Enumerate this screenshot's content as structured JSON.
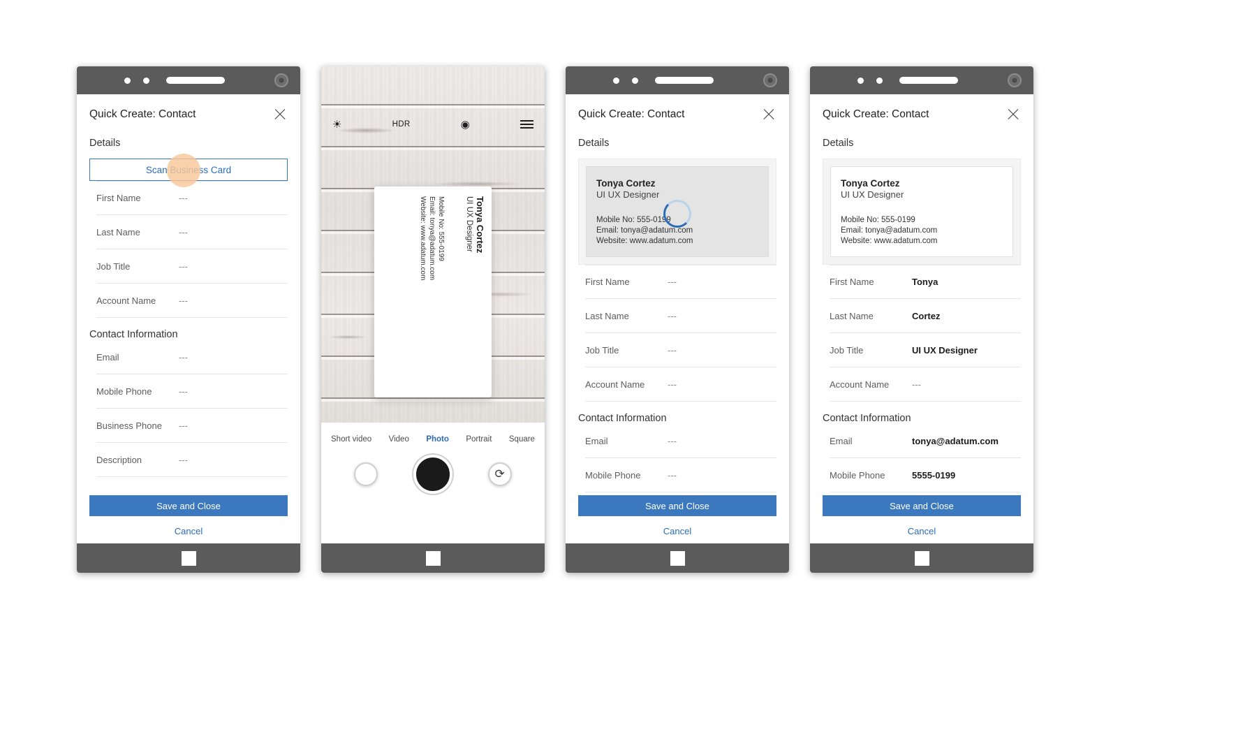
{
  "form": {
    "title": "Quick Create: Contact",
    "close_icon": "close-icon",
    "details_heading": "Details",
    "contact_info_heading": "Contact Information",
    "scan_button": "Scan Business Card",
    "save_button": "Save and Close",
    "cancel_link": "Cancel",
    "empty_value": "---"
  },
  "panel1": {
    "fields": [
      {
        "label": "First Name",
        "value": "---"
      },
      {
        "label": "Last Name",
        "value": "---"
      },
      {
        "label": "Job Title",
        "value": "---"
      },
      {
        "label": "Account Name",
        "value": "---"
      }
    ],
    "contact_fields": [
      {
        "label": "Email",
        "value": "---"
      },
      {
        "label": "Mobile Phone",
        "value": "---"
      },
      {
        "label": "Business Phone",
        "value": "---"
      },
      {
        "label": "Description",
        "value": "---"
      }
    ]
  },
  "panel3": {
    "card": {
      "name": "Tonya Cortez",
      "role": "UI UX Designer",
      "mobile": "Mobile No: 555-0199",
      "email": "Email: tonya@adatum.com",
      "website": "Website: www.adatum.com",
      "spinner": "loading-spinner"
    },
    "fields": [
      {
        "label": "First Name",
        "value": "---"
      },
      {
        "label": "Last Name",
        "value": "---"
      },
      {
        "label": "Job Title",
        "value": "---"
      },
      {
        "label": "Account Name",
        "value": "---"
      }
    ],
    "contact_fields": [
      {
        "label": "Email",
        "value": "---"
      },
      {
        "label": "Mobile Phone",
        "value": "---"
      }
    ]
  },
  "panel4": {
    "card": {
      "name": "Tonya Cortez",
      "role": "UI UX Designer",
      "mobile": "Mobile No: 555-0199",
      "email": "Email: tonya@adatum.com",
      "website": "Website: www.adatum.com"
    },
    "fields": [
      {
        "label": "First Name",
        "value": "Tonya"
      },
      {
        "label": "Last Name",
        "value": "Cortez"
      },
      {
        "label": "Job Title",
        "value": "UI UX Designer"
      },
      {
        "label": "Account Name",
        "value": "---"
      }
    ],
    "contact_fields": [
      {
        "label": "Email",
        "value": "tonya@adatum.com"
      },
      {
        "label": "Mobile Phone",
        "value": "5555-0199"
      }
    ]
  },
  "camera": {
    "controls": {
      "brightness_icon": "☀",
      "hdr_label": "HDR",
      "filter_icon": "◉",
      "menu_icon": "hamburger-menu-icon"
    },
    "modes": [
      "Short video",
      "Video",
      "Photo",
      "Portrait",
      "Square"
    ],
    "active_mode": "Photo",
    "gallery_button": "gallery-thumbnail",
    "shutter_button": "shutter-button",
    "flip_icon": "⟳",
    "business_card": {
      "name": "Tonya Cortez",
      "role": "UI UX Designer",
      "mobile": "Mobile No: 555-0199",
      "email": "Email: tonya@adatum.com",
      "website": "Website: www.adatum.com"
    }
  },
  "colors": {
    "accent_blue": "#2b6cb8",
    "button_blue": "#3b78bd",
    "bezel_gray": "#5b5b5b",
    "tap_highlight": "#f8c89a"
  }
}
